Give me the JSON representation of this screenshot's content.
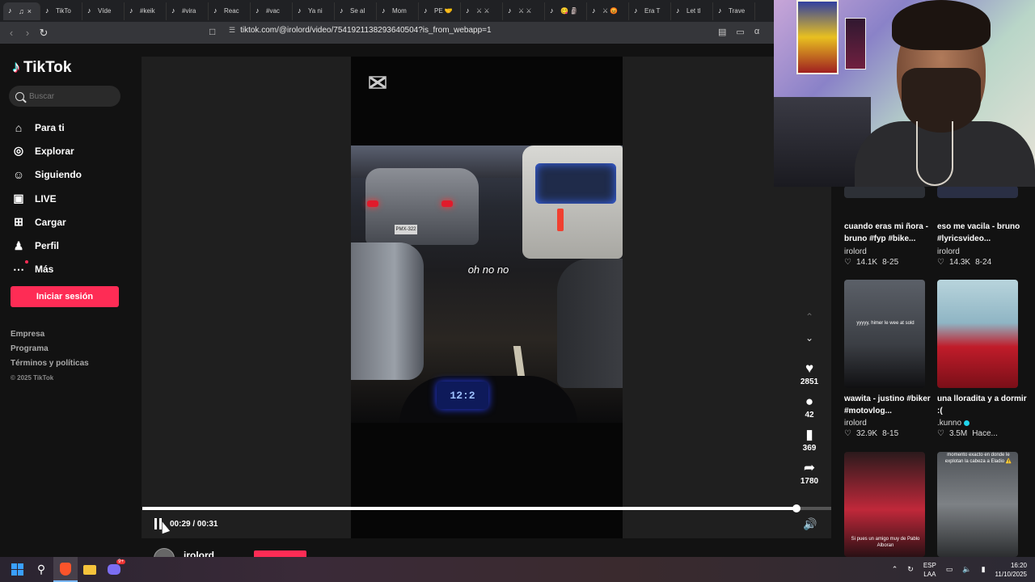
{
  "browser": {
    "tabs": [
      {
        "label": "",
        "active": true
      },
      {
        "label": "TikTo"
      },
      {
        "label": "Víde"
      },
      {
        "label": "#keik"
      },
      {
        "label": "#vira"
      },
      {
        "label": "Reac"
      },
      {
        "label": "#vac"
      },
      {
        "label": "Ya ni"
      },
      {
        "label": "Se al"
      },
      {
        "label": "Mom"
      },
      {
        "label": "PE 🤝"
      },
      {
        "label": "⚔ ⚔"
      },
      {
        "label": "⚔ ⚔"
      },
      {
        "label": "😋 🗿"
      },
      {
        "label": "⚔ 😡"
      },
      {
        "label": "Era T"
      },
      {
        "label": "Let tl"
      },
      {
        "label": "Trave"
      }
    ],
    "url": "tiktok.com/@irolord/video/7541921138293640504?is_from_webapp=1"
  },
  "sidebar": {
    "logo_text": "TikTok",
    "search_placeholder": "Buscar",
    "nav": [
      {
        "label": "Para ti",
        "icon": "home-icon"
      },
      {
        "label": "Explorar",
        "icon": "compass-icon"
      },
      {
        "label": "Siguiendo",
        "icon": "following-icon"
      },
      {
        "label": "LIVE",
        "icon": "live-icon"
      },
      {
        "label": "Cargar",
        "icon": "upload-icon"
      },
      {
        "label": "Perfil",
        "icon": "profile-icon"
      },
      {
        "label": "Más",
        "icon": "more-icon"
      }
    ],
    "login_label": "Iniciar sesión",
    "footer": [
      "Empresa",
      "Programa",
      "Términos y políticas"
    ],
    "copyright": "© 2025 TikTok"
  },
  "video": {
    "caption": "oh no no",
    "gauge_reading": "12:2",
    "plate_text": "PMX-322",
    "time_current": "00:29",
    "time_total": "00:31",
    "time_display": "00:29 / 00:31",
    "progress_fraction": 0.95,
    "author": "irolord"
  },
  "actions": {
    "likes": "2851",
    "comments": "42",
    "saves": "369",
    "shares": "1780"
  },
  "related": [
    {
      "title": "cuando eras mi ñora - bruno #fyp #bike...",
      "author": "irolord",
      "verified": false,
      "likes": "14.1K",
      "date": "8-25"
    },
    {
      "title": "eso me vacila - bruno #lyricsvideo...",
      "author": "irolord",
      "verified": false,
      "likes": "14.3K",
      "date": "8-24"
    },
    {
      "title": "wawita - justino #biker #motovlog...",
      "author": "irolord",
      "verified": false,
      "likes": "32.9K",
      "date": "8-15"
    },
    {
      "title": "una lloradita y a dormir :(",
      "author": ".kunno",
      "verified": true,
      "likes": "3.5M",
      "date": "Hace..."
    }
  ],
  "related_thumb_text": {
    "c": "yyyyy, himer le wee at sold",
    "e": "Si pues un amigo muy de Pablo Alboran",
    "f": "momento exacto en donde le explotan la cabeza a Eladio ⚠️"
  },
  "taskbar": {
    "lang_top": "ESP",
    "lang_bottom": "LAA",
    "time": "16:20",
    "date": "11/10/2025",
    "discord_badge": "9+"
  },
  "colors": {
    "accent": "#fe2c55",
    "background": "#121212"
  }
}
